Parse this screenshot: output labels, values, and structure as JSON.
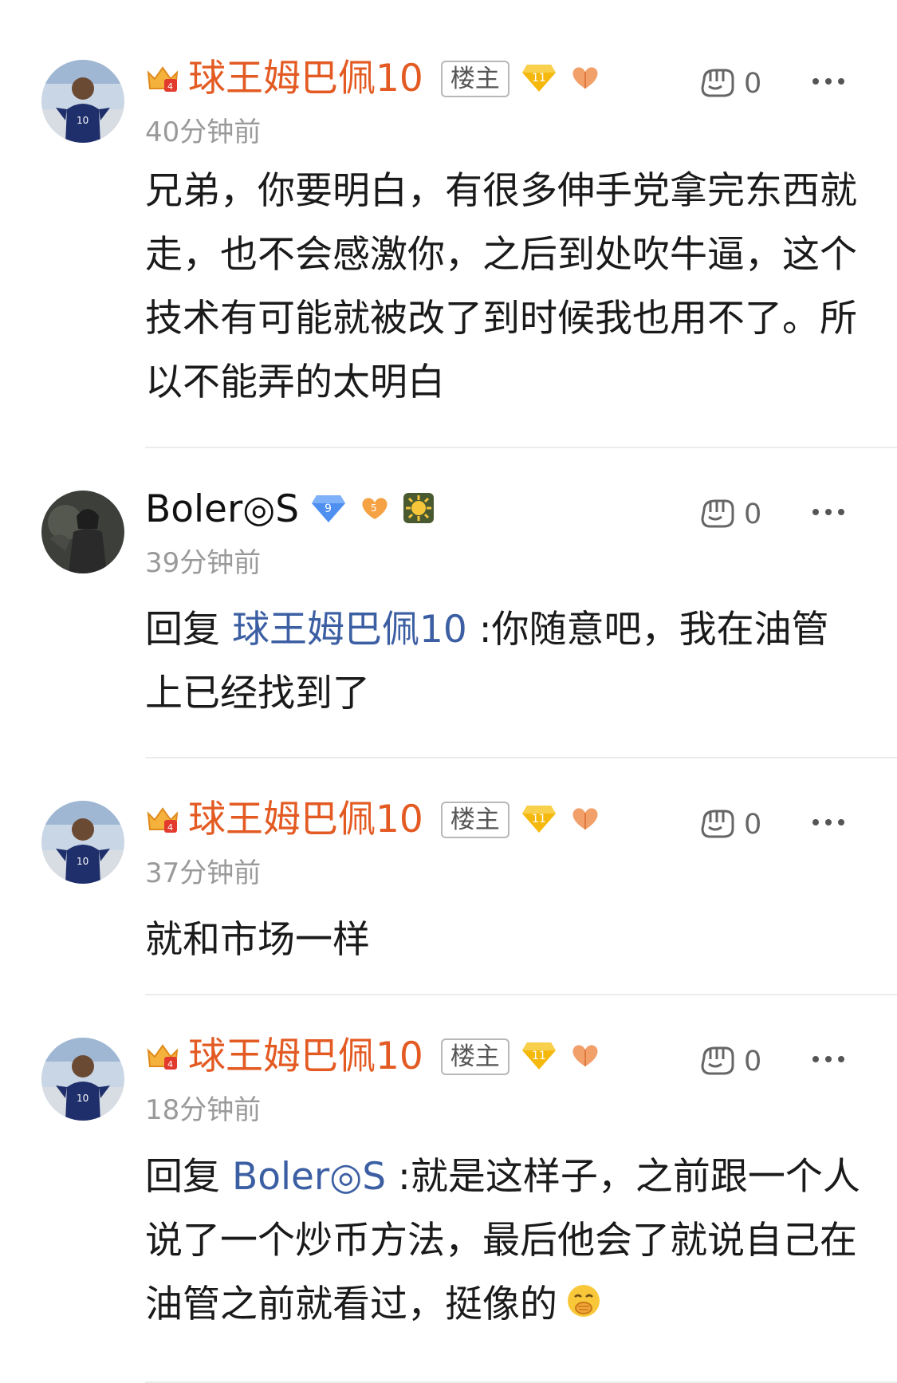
{
  "comments": [
    {
      "username": "球王姆巴佩10",
      "host_label": "楼主",
      "level_badge": "11",
      "time": "40分钟前",
      "like_count": "0",
      "text": "兄弟，你要明白，有很多伸手党拿完东西就走，也不会感激你，之后到处吹牛逼，这个技术有可能就被改了到时候我也用不了。所以不能弄的太明白"
    },
    {
      "username": "Boler◎S",
      "level_badge": "9",
      "fan_badge": "5",
      "time": "39分钟前",
      "like_count": "0",
      "reply_prefix": "回复",
      "reply_to": "球王姆巴佩10",
      "text": ":你随意吧，我在油管上已经找到了"
    },
    {
      "username": "球王姆巴佩10",
      "host_label": "楼主",
      "level_badge": "11",
      "time": "37分钟前",
      "like_count": "0",
      "text": "就和市场一样"
    },
    {
      "username": "球王姆巴佩10",
      "host_label": "楼主",
      "level_badge": "11",
      "time": "18分钟前",
      "like_count": "0",
      "reply_prefix": "回复",
      "reply_to": "Boler◎S",
      "text": ":就是这样子，之前跟一个人说了一个炒币方法，最后他会了就说自己在油管之前就看过，挺像的",
      "emoji": "covering-mouth-emoji"
    }
  ],
  "colors": {
    "username_orange": "#e35a22",
    "reply_link": "#3c5fa3",
    "time_gray": "#9a9a9a"
  },
  "icons": [
    "crown-icon",
    "level-diamond-icon",
    "heart-hands-icon",
    "sun-badge-icon",
    "like-fist-icon",
    "more-icon"
  ]
}
